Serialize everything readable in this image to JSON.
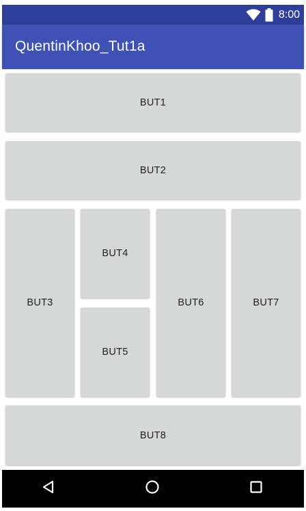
{
  "status_bar": {
    "time": "8:00",
    "icons": [
      "wifi-icon",
      "battery-icon"
    ]
  },
  "app_bar": {
    "title": "QuentinKhoo_Tut1a"
  },
  "buttons": {
    "but1": "BUT1",
    "but2": "BUT2",
    "but3": "BUT3",
    "but4": "BUT4",
    "but5": "BUT5",
    "but6": "BUT6",
    "but7": "BUT7",
    "but8": "BUT8"
  },
  "nav_bar": {
    "icons": [
      "back-icon",
      "home-icon",
      "recents-icon"
    ]
  },
  "colors": {
    "status_bar": "#2f3e98",
    "app_bar": "#3f51b5",
    "button_bg": "#d6d7d7",
    "nav_bar": "#000000"
  }
}
